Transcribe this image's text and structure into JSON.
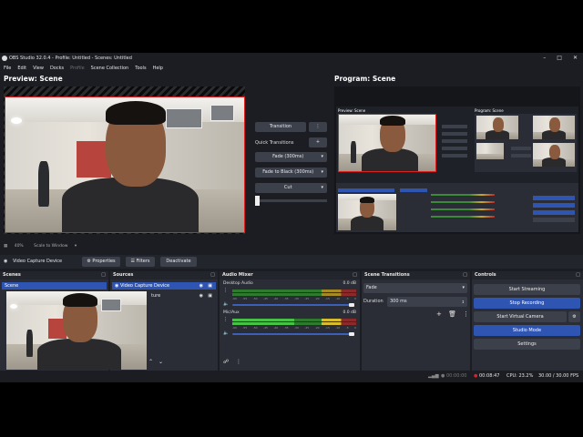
{
  "window": {
    "title": "OBS Studio 32.0.4 - Profile: Untitled - Scenes: Untitled",
    "controls": [
      "–",
      "□",
      "✕"
    ]
  },
  "menu": [
    "File",
    "Edit",
    "View",
    "Docks",
    "Profile",
    "Scene Collection",
    "Tools",
    "Help"
  ],
  "preview": {
    "title": "Preview: Scene"
  },
  "program": {
    "title": "Program: Scene"
  },
  "transitions_bar": {
    "transition_label": "Transition",
    "more_icon": "⋮",
    "quick_transitions": "Quick Transitions",
    "add_icon": "+",
    "fade_label": "Fade (300ms)",
    "fade_black_label": "Fade to Black (300ms)",
    "cut_label": "Cut"
  },
  "zoom": {
    "value": "40%",
    "scale_mode": "Scale to Window"
  },
  "source_toolbar": {
    "source_name": "Video Capture Device",
    "properties": "Properties",
    "filters": "Filters",
    "deactivate": "Deactivate"
  },
  "scenes": {
    "header": "Scenes",
    "items": [
      "Scene"
    ]
  },
  "sources": {
    "header": "Sources",
    "items": [
      "Video Capture Device"
    ],
    "partial_text": "ture"
  },
  "audio": {
    "header": "Audio Mixer",
    "channels": [
      {
        "name": "Desktop Audio",
        "db": "0.0 dB"
      },
      {
        "name": "Mic/Aux",
        "db": "0.0 dB"
      }
    ],
    "scale": [
      "-60",
      "-55",
      "-50",
      "-45",
      "-40",
      "-35",
      "-30",
      "-25",
      "-20",
      "-15",
      "-10",
      "-5",
      "0"
    ]
  },
  "scene_transitions": {
    "header": "Scene Transitions",
    "type": "Fade",
    "duration_label": "Duration",
    "duration_value": "300 ms"
  },
  "controls": {
    "header": "Controls",
    "start_streaming": "Start Streaming",
    "stop_recording": "Stop Recording",
    "start_virtual_camera": "Start Virtual Camera",
    "studio_mode": "Studio Mode",
    "settings": "Settings"
  },
  "status": {
    "stream_time": "00:00:00",
    "rec_time": "00:08:47",
    "cpu": "CPU: 23.2%",
    "fps": "30.00 / 30.00 FPS"
  },
  "colors": {
    "accent": "#2f55b3",
    "record_red": "#e02020",
    "bg": "#1b1d23"
  }
}
